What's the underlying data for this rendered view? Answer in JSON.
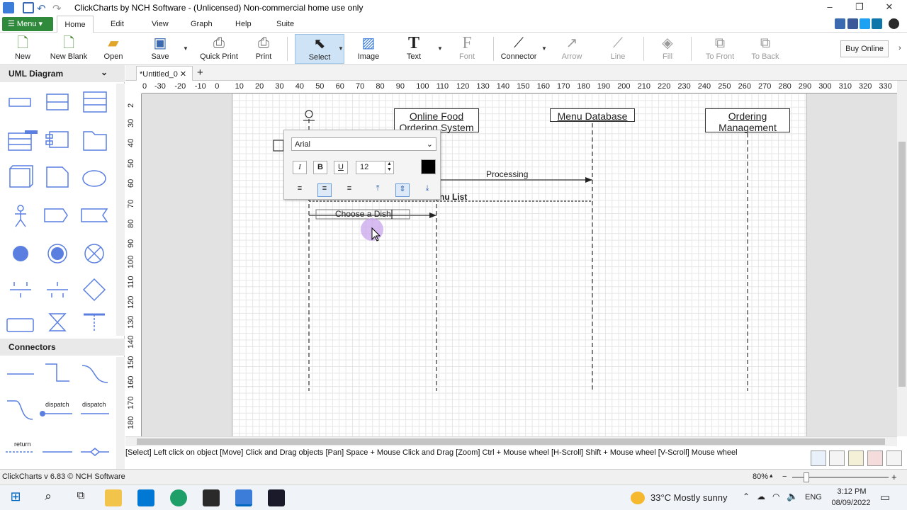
{
  "app": {
    "title": "ClickCharts by NCH Software - (Unlicensed) Non-commercial home use only",
    "version": "ClickCharts v 6.83 © NCH Software"
  },
  "menubar": {
    "menu_label": "Menu",
    "tabs": [
      "Home",
      "Edit",
      "View",
      "Graph",
      "Help",
      "Suite"
    ]
  },
  "toolbar": {
    "new": "New",
    "new_blank": "New Blank",
    "open": "Open",
    "save": "Save",
    "quick_print": "Quick Print",
    "print": "Print",
    "select": "Select",
    "image": "Image",
    "text": "Text",
    "font": "Font",
    "connector": "Connector",
    "arrow": "Arrow",
    "line": "Line",
    "fill": "Fill",
    "to_front": "To Front",
    "to_back": "To Back",
    "buy_online": "Buy Online"
  },
  "left_panel": {
    "uml_header": "UML Diagram",
    "connectors_header": "Connectors",
    "connector_labels": [
      "dispatch",
      "dispatch",
      "return"
    ]
  },
  "document": {
    "tab_name": "*Untitled_0"
  },
  "rulers": {
    "horizontal": [
      "0",
      "-30",
      "-20",
      "-10",
      "0",
      "10",
      "20",
      "30",
      "40",
      "50",
      "60",
      "70",
      "80",
      "90",
      "100",
      "110",
      "120",
      "130",
      "140",
      "150",
      "160",
      "170",
      "180",
      "190",
      "200",
      "210",
      "220",
      "230",
      "240",
      "250",
      "260",
      "270",
      "280",
      "290",
      "300",
      "310",
      "320",
      "330"
    ],
    "vertical": [
      "2",
      "30",
      "40",
      "50",
      "60",
      "70",
      "80",
      "90",
      "100",
      "110",
      "120",
      "130",
      "140",
      "150",
      "160",
      "170",
      "180"
    ]
  },
  "diagram": {
    "lifelines": [
      {
        "name_line1": "Online Food",
        "name_line2": "Ordering System"
      },
      {
        "name_line1": "Menu Database",
        "name_line2": ""
      },
      {
        "name_line1": "Ordering",
        "name_line2": "Management"
      }
    ],
    "messages": {
      "processing": "Processing",
      "menu_list_partial": "nu List",
      "editing_text": "Choose a Dish"
    }
  },
  "text_popup": {
    "font_family": "Arial",
    "italic": "I",
    "bold": "B",
    "underline": "U",
    "font_size": "12",
    "text_color": "#000000"
  },
  "status": {
    "help_text": "[Select] Left click on object  [Move] Click and Drag objects  [Pan] Space + Mouse Click and Drag  [Zoom] Ctrl + Mouse wheel  [H-Scroll] Shift + Mouse wheel  [V-Scroll] Mouse wheel",
    "zoom": "80%"
  },
  "taskbar": {
    "weather": "33°C  Mostly sunny",
    "language": "ENG",
    "time": "3:12 PM",
    "date": "08/09/2022"
  },
  "colors": {
    "menu_green": "#2f8a3c",
    "select_bg": "#cfe3f7",
    "shape_blue": "#5a7fe0",
    "cursor_highlight": "#c9a6ee"
  }
}
